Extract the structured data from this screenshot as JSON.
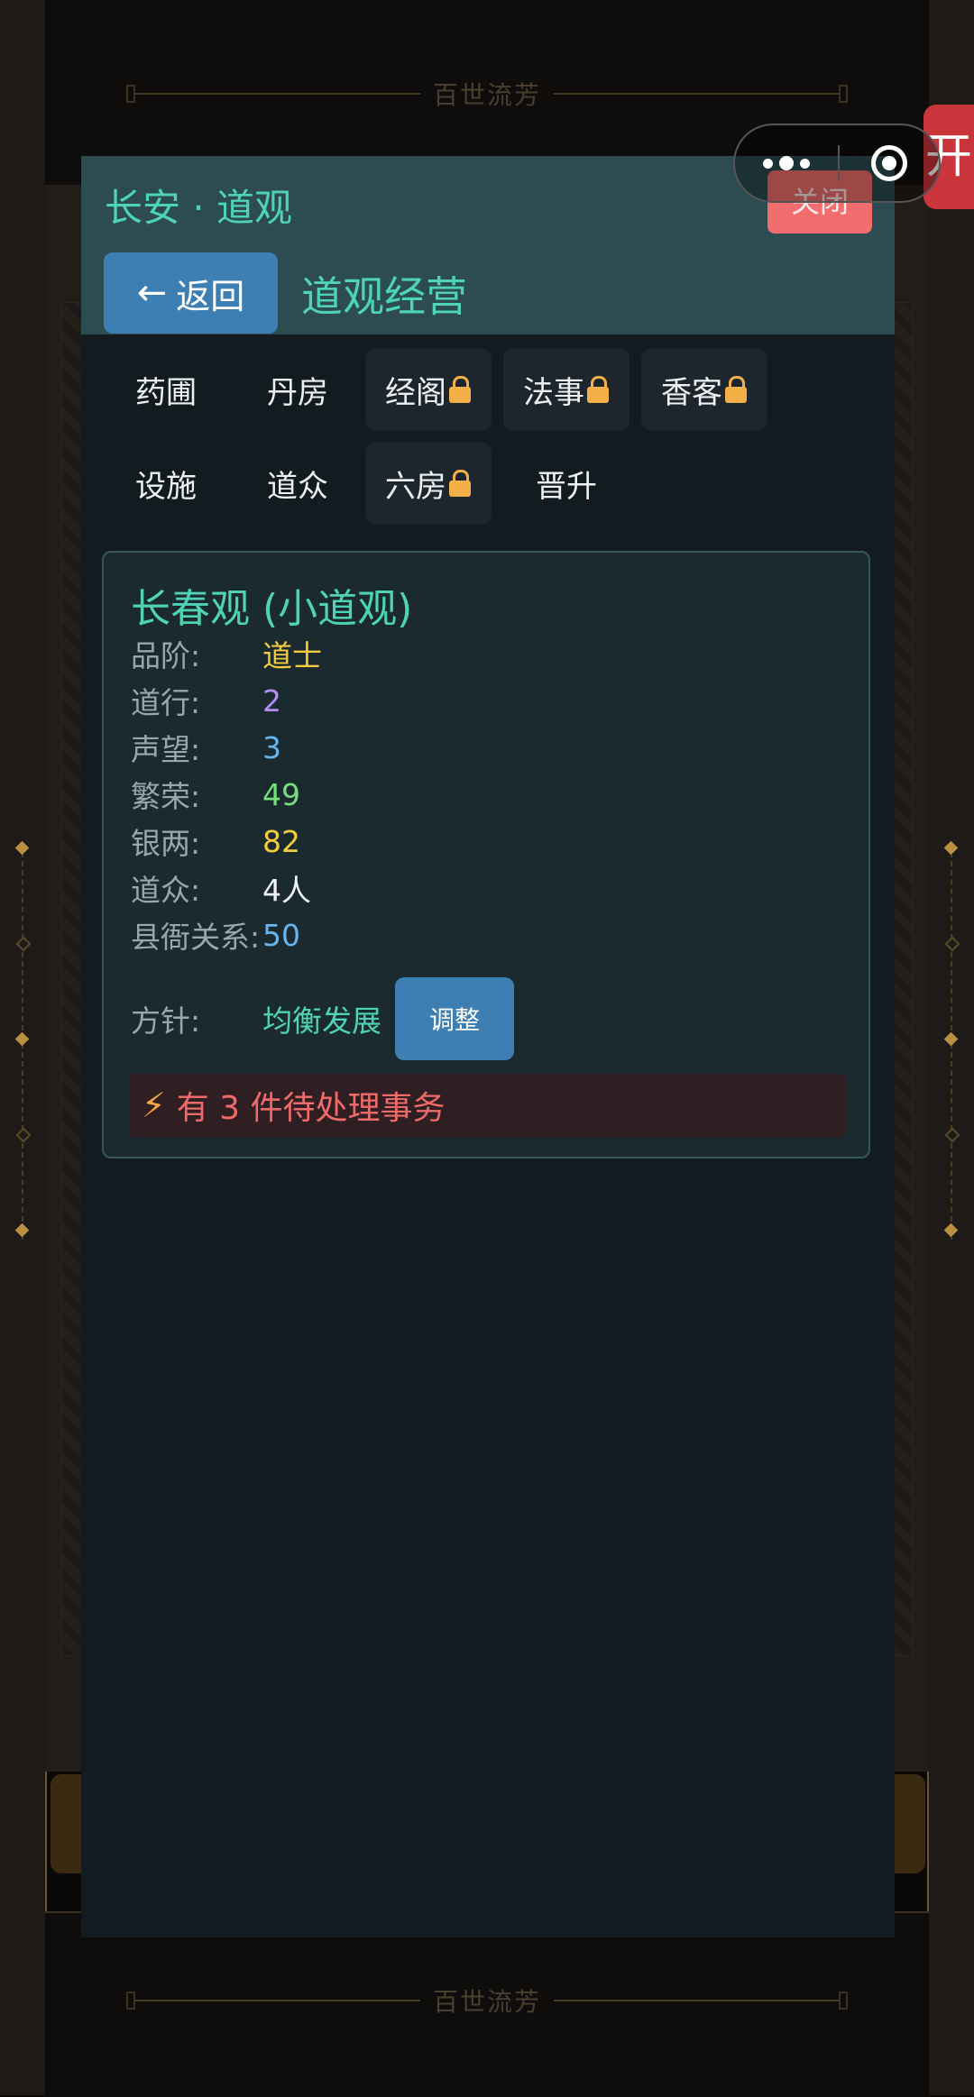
{
  "background": {
    "banner_text": "百世流芳",
    "side_tab_glyph": "开"
  },
  "modal": {
    "title": "长安 · 道观",
    "close_label": "关闭",
    "back_label": "返回",
    "back_icon": "left-arrow-icon",
    "subtitle": "道观经营"
  },
  "tabs": [
    {
      "label": "药圃",
      "locked": false
    },
    {
      "label": "丹房",
      "locked": false
    },
    {
      "label": "经阁",
      "locked": true
    },
    {
      "label": "法事",
      "locked": true
    },
    {
      "label": "香客",
      "locked": true
    },
    {
      "label": "设施",
      "locked": false
    },
    {
      "label": "道众",
      "locked": false
    },
    {
      "label": "六房",
      "locked": true
    },
    {
      "label": "晋升",
      "locked": false
    }
  ],
  "card": {
    "title": "长春观 (小道观)",
    "stats": [
      {
        "label": "品阶:",
        "value": "道士",
        "color": "#f2cc3d"
      },
      {
        "label": "道行:",
        "value": "2",
        "color": "#b38cf5"
      },
      {
        "label": "声望:",
        "value": "3",
        "color": "#67b4f0"
      },
      {
        "label": "繁荣:",
        "value": "49",
        "color": "#73e07a"
      },
      {
        "label": "银两:",
        "value": "82",
        "color": "#f2cc3d"
      },
      {
        "label": "道众:",
        "value": "4人",
        "color": "#eef2f4"
      },
      {
        "label": "县衙关系:",
        "value": "50",
        "color": "#67b4f0"
      }
    ],
    "policy_label": "方针:",
    "policy_value": "均衡发展",
    "adjust_label": "调整",
    "alert_text": "有 3 件待处理事务",
    "alert_icon": "lightning-icon"
  },
  "colors": {
    "accent": "#4fd3b6",
    "button": "#3d7fb3",
    "close": "#f26d6d",
    "lock": "#f3b048",
    "alert": "#f06a6a"
  }
}
